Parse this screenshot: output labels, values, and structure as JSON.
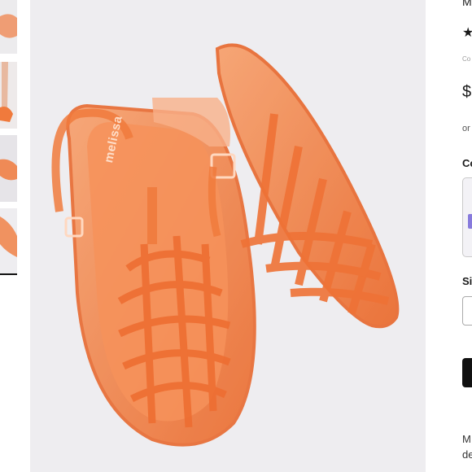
{
  "product": {
    "brand_emboss": "melissa",
    "rating_star": "★",
    "review_count": "Co",
    "price": "$",
    "payment_note": "or",
    "color_label": "Co",
    "size_label": "Si",
    "description_lines": [
      "M",
      "de",
      "..."
    ],
    "title_fragment": "M"
  },
  "icons": {
    "star": "star-icon"
  },
  "colors": {
    "sandal": "#f07a3c",
    "background": "#eeedf0",
    "button": "#111111"
  }
}
